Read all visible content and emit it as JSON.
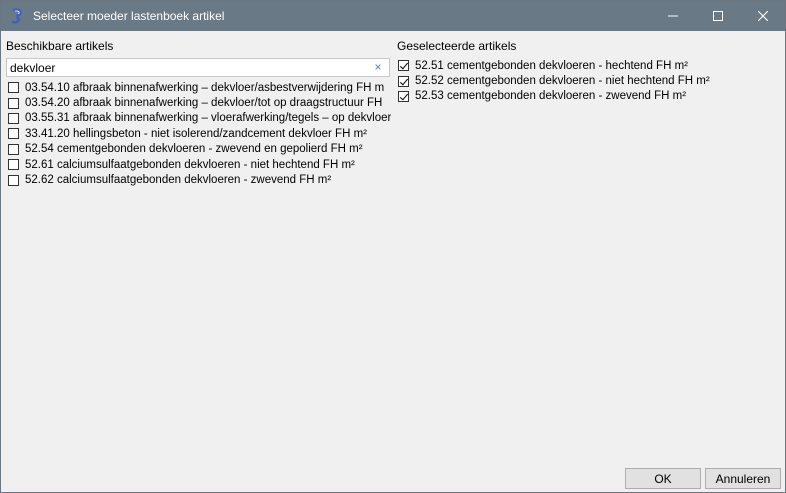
{
  "window": {
    "title": "Selecteer moeder lastenboek artikel"
  },
  "left": {
    "label": "Beschikbare artikels",
    "search_value": "dekvloer",
    "clear_glyph": "×",
    "items": [
      {
        "text": "03.54.10 afbraak binnenafwerking – dekvloer/asbestverwijdering FH m",
        "checked": false
      },
      {
        "text": "03.54.20 afbraak binnenafwerking – dekvloer/tot op draagstructuur FH",
        "checked": false
      },
      {
        "text": "03.55.31 afbraak binnenafwerking – vloerafwerking/tegels – op dekvloer",
        "checked": false
      },
      {
        "text": "33.41.20 hellingsbeton - niet isolerend/zandcement dekvloer FH m²",
        "checked": false
      },
      {
        "text": "52.54 cementgebonden dekvloeren - zwevend en gepolierd FH m²",
        "checked": false
      },
      {
        "text": "52.61 calciumsulfaatgebonden dekvloeren - niet hechtend FH m²",
        "checked": false
      },
      {
        "text": "52.62 calciumsulfaatgebonden dekvloeren - zwevend FH m²",
        "checked": false
      }
    ]
  },
  "right": {
    "label": "Geselecteerde artikels",
    "items": [
      {
        "text": "52.51 cementgebonden dekvloeren - hechtend FH m²",
        "checked": true
      },
      {
        "text": "52.52 cementgebonden dekvloeren - niet hechtend FH m²",
        "checked": true
      },
      {
        "text": "52.53 cementgebonden dekvloeren - zwevend FH m²",
        "checked": true
      }
    ]
  },
  "buttons": {
    "ok": "OK",
    "cancel": "Annuleren"
  },
  "icons": {
    "app": "app-logo-icon",
    "minimize": "minimize-icon",
    "maximize": "maximize-icon",
    "close": "close-icon",
    "clear": "clear-search-icon"
  },
  "colors": {
    "titlebar": "#697986",
    "background": "#f0f0f0"
  }
}
